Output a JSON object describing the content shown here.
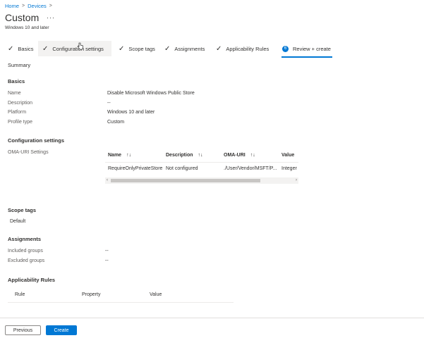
{
  "breadcrumb": {
    "home": "Home",
    "devices": "Devices",
    "sep": ">"
  },
  "header": {
    "title": "Custom",
    "more": "···",
    "subtitle": "Windows 10 and later"
  },
  "tabs": [
    {
      "label": "Basics",
      "state": "done"
    },
    {
      "label": "Configuration settings",
      "state": "done"
    },
    {
      "label": "Scope tags",
      "state": "done"
    },
    {
      "label": "Assignments",
      "state": "done"
    },
    {
      "label": "Applicability Rules",
      "state": "done"
    },
    {
      "label": "Review + create",
      "state": "active",
      "number": "6"
    }
  ],
  "summary": {
    "heading": "Summary",
    "basics": {
      "heading": "Basics",
      "rows": [
        {
          "label": "Name",
          "value": "Disable Microsoft Windows Public Store"
        },
        {
          "label": "Description",
          "value": "--"
        },
        {
          "label": "Platform",
          "value": "Windows 10 and later"
        },
        {
          "label": "Profile type",
          "value": "Custom"
        }
      ]
    },
    "configuration": {
      "heading": "Configuration settings",
      "oma_label": "OMA-URI Settings",
      "columns": [
        "Name",
        "Description",
        "OMA-URI",
        "Value"
      ],
      "sort_glyph": "↑↓",
      "rows": [
        [
          "RequireOnlyPrivateStore",
          "Not configured",
          "./User/Vendor/MSFT/P...",
          "Integer"
        ]
      ]
    },
    "scope_tags": {
      "heading": "Scope tags",
      "items": [
        "Default"
      ]
    },
    "assignments": {
      "heading": "Assignments",
      "rows": [
        {
          "label": "Included groups",
          "value": "--"
        },
        {
          "label": "Excluded groups",
          "value": "--"
        }
      ]
    },
    "applicability": {
      "heading": "Applicability Rules",
      "columns": [
        "Rule",
        "Property",
        "Value"
      ]
    }
  },
  "footer": {
    "previous": "Previous",
    "create": "Create"
  },
  "colors": {
    "accent": "#0078d4",
    "text": "#323130",
    "muted": "#605e5c"
  }
}
